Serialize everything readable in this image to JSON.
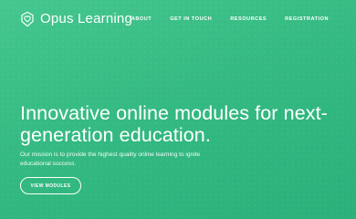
{
  "brand": {
    "name": "Opus Learning",
    "icon": "leaf-heart-icon"
  },
  "nav": {
    "items": [
      {
        "label": "ABOUT"
      },
      {
        "label": "GET IN TOUCH"
      },
      {
        "label": "RESOURCES"
      },
      {
        "label": "REGISTRATION"
      }
    ]
  },
  "hero": {
    "title": "Innovative online modules for next-generation education.",
    "subtitle": "Our mission is to provide the highest quality online learning to ignite educational success.",
    "cta_label": "VIEW MODULES"
  },
  "colors": {
    "background_start": "#45c78f",
    "background_end": "#2ab07a",
    "text": "#ffffff"
  }
}
